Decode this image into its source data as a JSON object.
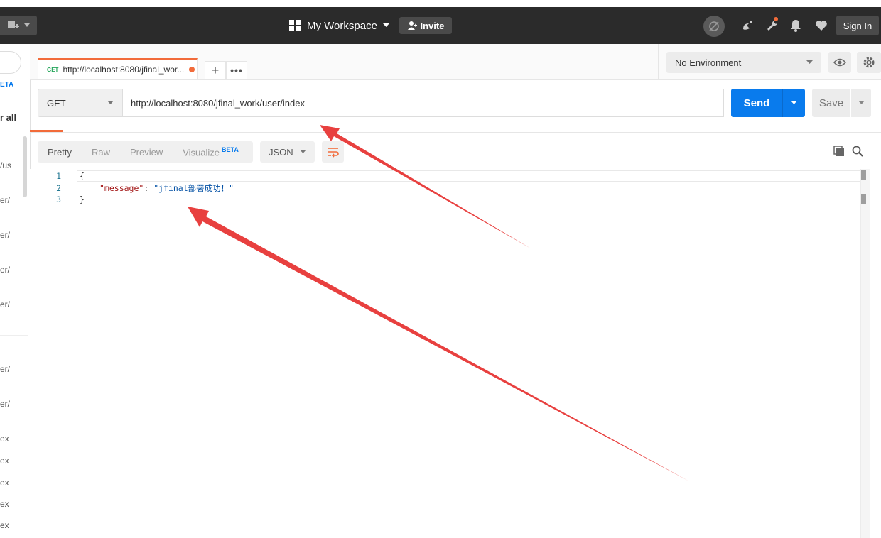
{
  "header": {
    "workspace_label": "My Workspace",
    "invite_label": "Invite",
    "signin_label": "Sign In"
  },
  "sidebar": {
    "beta_label": "ETA",
    "view_all_label": "r all",
    "items": [
      "/us",
      "er/",
      "er/",
      "er/",
      "er/",
      "er/",
      "er/",
      "ex",
      "ex",
      "ex",
      "ex",
      "ex"
    ]
  },
  "tabs": [
    {
      "method": "GET",
      "url": "http://localhost:8080/jfinal_wor...",
      "modified": true
    }
  ],
  "environment": {
    "selected": "No Environment"
  },
  "request": {
    "method": "GET",
    "url": "http://localhost:8080/jfinal_work/user/index",
    "send_label": "Send",
    "save_label": "Save"
  },
  "response": {
    "views": [
      "Pretty",
      "Raw",
      "Preview",
      "Visualize"
    ],
    "visualize_badge": "BETA",
    "format": "JSON",
    "line_numbers": [
      "1",
      "2",
      "3"
    ],
    "lines": {
      "open": "{",
      "key": "\"message\"",
      "colon": ":",
      "value": "\"jfinal部署成功！\"",
      "close": "}"
    }
  },
  "colors": {
    "header_bg": "#2b2b2b",
    "accent_orange": "#f26b3a",
    "send_blue": "#097bed",
    "json_key": "#a31515",
    "json_string": "#0451a5",
    "annotation_arrow": "#e8403f"
  }
}
